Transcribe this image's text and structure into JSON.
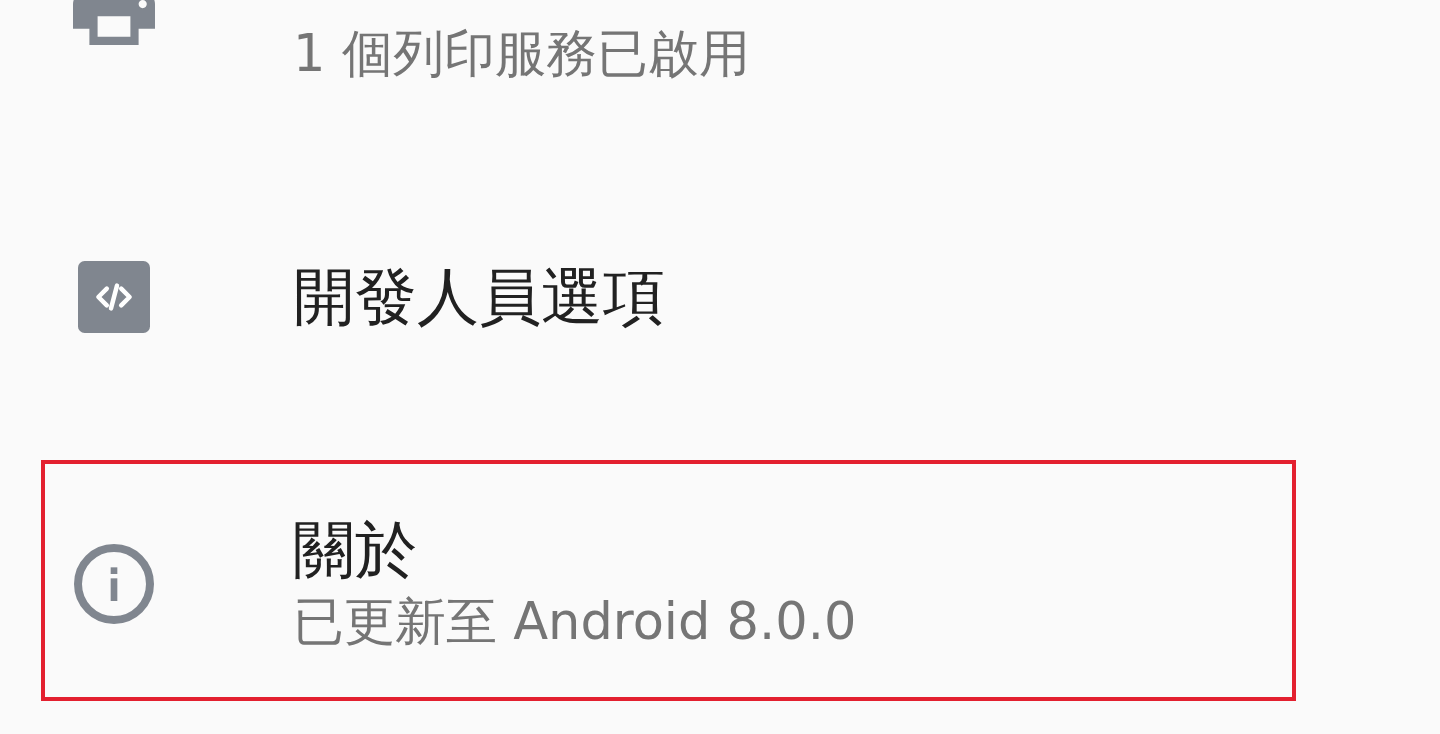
{
  "items": [
    {
      "kind": "printer",
      "subtitle": "1 個列印服務已啟用",
      "highlighted": false
    },
    {
      "kind": "code",
      "title": "開發人員選項",
      "highlighted": false
    },
    {
      "kind": "info",
      "title": "關於",
      "subtitle": "已更新至 Android 8.0.0",
      "highlighted": true
    }
  ]
}
